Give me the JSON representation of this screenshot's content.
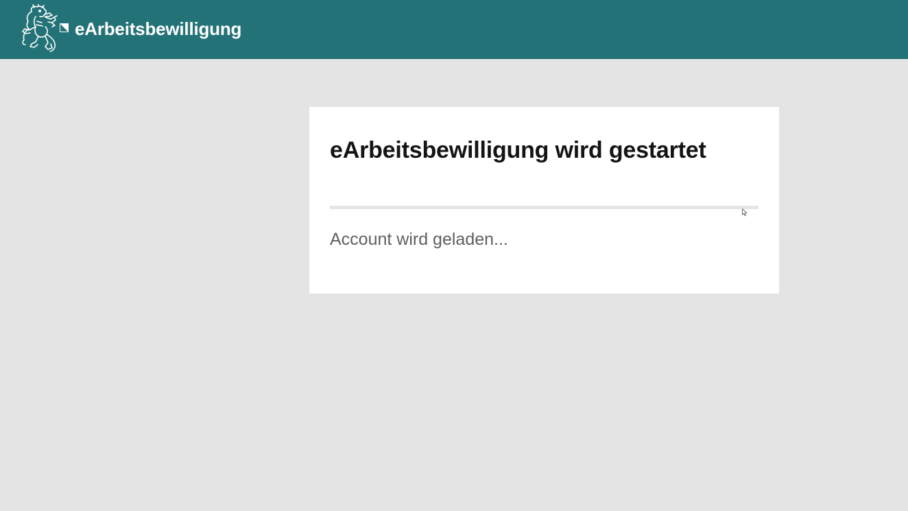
{
  "header": {
    "app_title": "eArbeitsbewilligung",
    "background_color": "#237277",
    "logo_icon": "lion-crest-icon",
    "mark_icon": "diagonal-corner-icon"
  },
  "card": {
    "title": "eArbeitsbewilligung wird gestartet",
    "progress": 0,
    "status": "Account wird geladen..."
  },
  "colors": {
    "page_background": "#e4e4e4",
    "card_background": "#ffffff",
    "title_text": "#141414",
    "status_text": "#5f5f5f",
    "progress_track": "#e6e6e6"
  }
}
